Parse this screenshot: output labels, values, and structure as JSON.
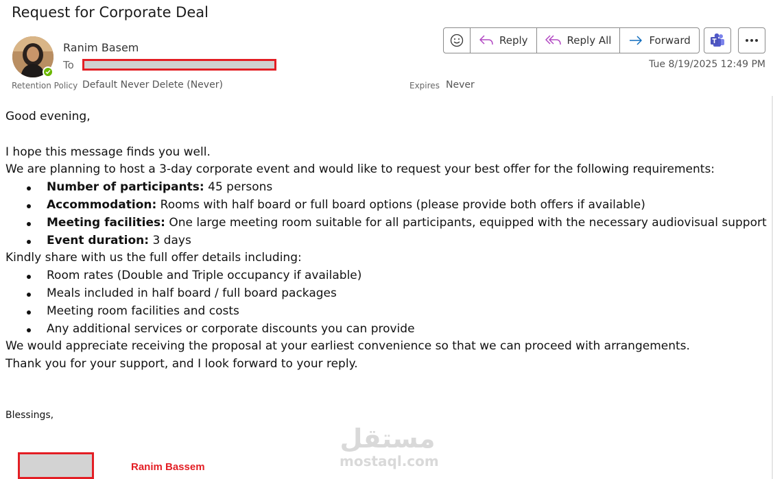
{
  "email": {
    "subject": "Request for Corporate Deal",
    "sender": "Ranim Basem",
    "to_label": "To",
    "date": "Tue 8/19/2025 12:49 PM",
    "retention_label": "Retention Policy",
    "retention_value": "Default Never Delete (Never)",
    "expires_label": "Expires",
    "expires_value": "Never"
  },
  "toolbar": {
    "reply": "Reply",
    "reply_all": "Reply All",
    "forward": "Forward"
  },
  "colors": {
    "reply_icon": "#b146c2",
    "forward_icon": "#0f6cbd",
    "redaction": "#e31e24",
    "presence": "#6bb700"
  },
  "body": {
    "greeting": "Good evening,",
    "intro1": "I hope this message finds you well.",
    "intro2": "We are planning to host a 3-day corporate event and would like to request your best offer for the following requirements:",
    "requirements": [
      {
        "label": "Number of participants:",
        "text": " 45 persons"
      },
      {
        "label": "Accommodation:",
        "text": " Rooms with half board or full board options (please provide both offers if available)"
      },
      {
        "label": "Meeting facilities:",
        "text": " One large meeting room suitable for all participants, equipped with the necessary audiovisual support"
      },
      {
        "label": "Event duration:",
        "text": " 3 days"
      }
    ],
    "details_intro": "Kindly share with us the full offer details including:",
    "details": [
      "Room rates (Double and Triple occupancy if available)",
      "Meals included in half board / full board packages",
      "Meeting room facilities and costs",
      "Any additional services or corporate discounts you can provide"
    ],
    "closing1": "We would appreciate receiving the proposal at your earliest convenience so that we can proceed with arrangements.",
    "closing2": "Thank you for your support, and I look forward to your reply.",
    "blessings": "Blessings,",
    "signature_name": "Ranim Bassem"
  },
  "watermark": {
    "arabic": "مستقل",
    "latin": "mostaql.com"
  }
}
